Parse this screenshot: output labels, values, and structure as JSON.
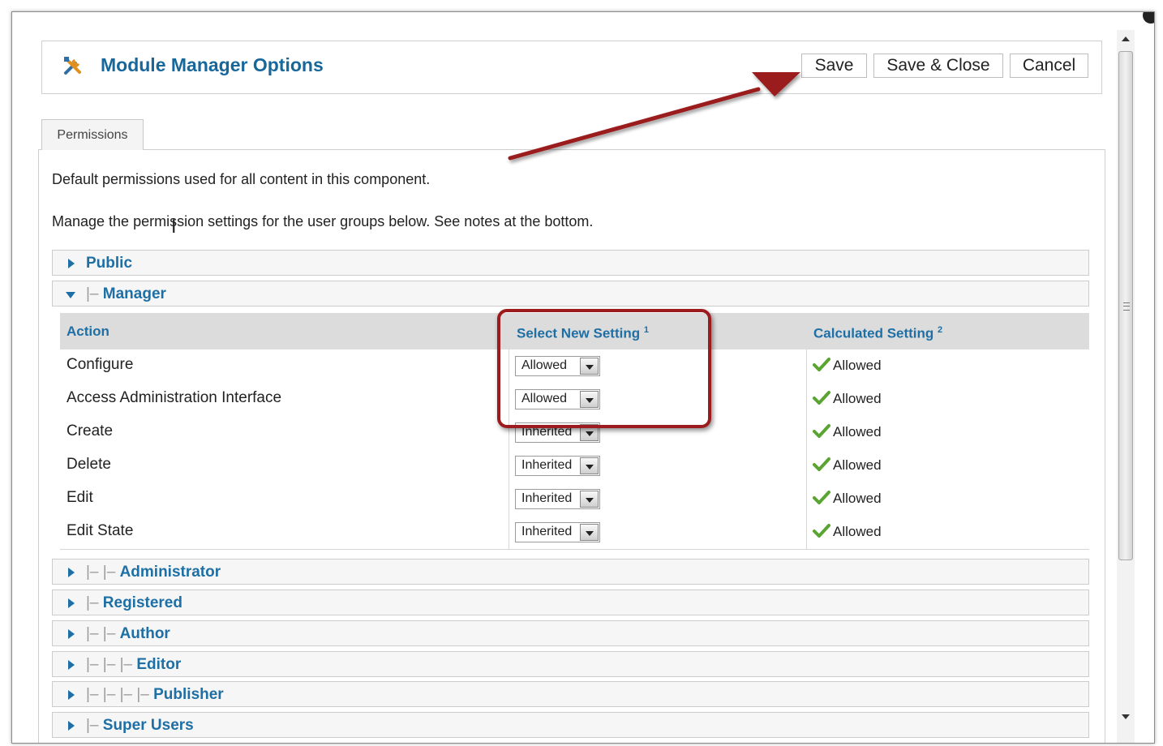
{
  "header": {
    "title": "Module Manager Options",
    "icon": "tools-icon",
    "buttons": {
      "save": "Save",
      "save_close": "Save & Close",
      "cancel": "Cancel"
    }
  },
  "tabs": [
    {
      "label": "Permissions"
    }
  ],
  "description": {
    "line1": "Default permissions used for all content in this component.",
    "line2": "Manage the permission settings for the user groups below. See notes at the bottom."
  },
  "groups": [
    {
      "tree": "",
      "name": "Public",
      "expanded": false
    },
    {
      "tree": "|– ",
      "name": "Manager",
      "expanded": true
    },
    {
      "tree": "|– |– ",
      "name": "Administrator",
      "expanded": false
    },
    {
      "tree": "|– ",
      "name": "Registered",
      "expanded": false
    },
    {
      "tree": "|– |– ",
      "name": "Author",
      "expanded": false
    },
    {
      "tree": "|– |– |– ",
      "name": "Editor",
      "expanded": false
    },
    {
      "tree": "|– |– |– |– ",
      "name": "Publisher",
      "expanded": false
    },
    {
      "tree": "|– ",
      "name": "Super Users",
      "expanded": false
    }
  ],
  "table": {
    "headers": {
      "action": "Action",
      "select": "Select New Setting",
      "select_note": "1",
      "calculated": "Calculated Setting",
      "calculated_note": "2"
    },
    "rows": [
      {
        "action": "Configure",
        "setting": "Allowed",
        "calculated": "Allowed"
      },
      {
        "action": "Access Administration Interface",
        "setting": "Allowed",
        "calculated": "Allowed"
      },
      {
        "action": "Create",
        "setting": "Inherited",
        "calculated": "Allowed"
      },
      {
        "action": "Delete",
        "setting": "Inherited",
        "calculated": "Allowed"
      },
      {
        "action": "Edit",
        "setting": "Inherited",
        "calculated": "Allowed"
      },
      {
        "action": "Edit State",
        "setting": "Inherited",
        "calculated": "Allowed"
      }
    ]
  },
  "colors": {
    "link_blue": "#1d6fa5",
    "annotation_red": "#9b1b1e",
    "check_green": "#5aa532"
  }
}
